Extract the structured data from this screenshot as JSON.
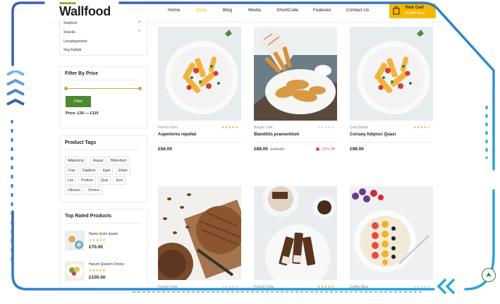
{
  "header": {
    "logo_text": "Wallfood",
    "nav": [
      {
        "label": "Home",
        "active": false
      },
      {
        "label": "Shop",
        "active": true
      },
      {
        "label": "Blog",
        "active": false
      },
      {
        "label": "Media",
        "active": false
      },
      {
        "label": "ShortCode",
        "active": false
      },
      {
        "label": "Features",
        "active": false
      },
      {
        "label": "Contact Us",
        "active": false
      }
    ],
    "cart": {
      "label": "Your Cart",
      "amount": "(0.00)0 Item)",
      "icon": "shopping-bag-icon"
    }
  },
  "sidebar": {
    "categories": [
      {
        "label": "Seafood",
        "expandable": true
      },
      {
        "label": "Snacks",
        "expandable": true
      },
      {
        "label": "Uncategorized",
        "expandable": false
      },
      {
        "label": "Veg Kabab",
        "expandable": false
      }
    ],
    "filter": {
      "title": "Filter By Price",
      "button_label": "Filter",
      "price_label": "Price: £30 — £110",
      "range_min_fraction": 0.0,
      "range_max_fraction": 1.0
    },
    "tags": {
      "title": "Product Tags",
      "items": [
        "Adipiscing",
        "Augue",
        "Bibendum",
        "Cras",
        "Dapibus",
        "Eget",
        "Etiam",
        "Leo",
        "Pretium",
        "Quis",
        "Sem",
        "Ultricies",
        "Viverra"
      ]
    },
    "top_rated": {
      "title": "Top Rated Products",
      "items": [
        {
          "name": "Nemo Enim Ipsam",
          "stars": "★★★★★",
          "price": "£70.00"
        },
        {
          "name": "Harum Quidem Omnis",
          "stars": "★★★★★",
          "price": "£100.00"
        }
      ]
    }
  },
  "products": [
    {
      "category": "French Fries",
      "rating": 5,
      "name": "Asperiores repellat",
      "price": "£56.00",
      "old_price": "",
      "badge": ""
    },
    {
      "category": "Burger Cole",
      "rating": 0,
      "name": "Blanditiis praesentium",
      "price": "£88.00",
      "old_price": "£100.00",
      "badge": "-12% Off"
    },
    {
      "category": "Cold Drinks",
      "rating": 4,
      "name": "Conseq Adipisci Quasi",
      "price": "£98.00",
      "old_price": "",
      "badge": ""
    },
    {
      "category": "French Fries",
      "rating": 0,
      "name": "",
      "price": "",
      "old_price": "",
      "badge": ""
    },
    {
      "category": "French Fries",
      "rating": 5,
      "name": "",
      "price": "",
      "old_price": "",
      "badge": ""
    },
    {
      "category": "Coffee Mug",
      "rating": 0,
      "name": "",
      "price": "",
      "old_price": "",
      "badge": ""
    }
  ],
  "colors": {
    "accent_yellow": "#f5b800",
    "brand_green": "#4b8a2f",
    "star": "#f5a623",
    "frame_blue": "#3a5fb0",
    "frame_cyan": "#2aa6d8"
  }
}
